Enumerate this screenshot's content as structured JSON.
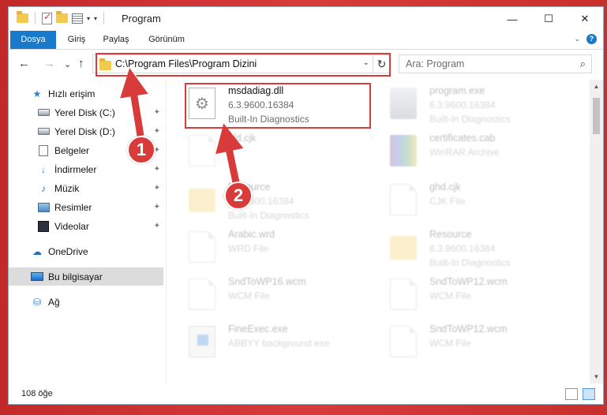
{
  "window": {
    "title": "Program",
    "controls": {
      "minimize": "—",
      "maximize": "☐",
      "close": "✕"
    }
  },
  "ribbon": {
    "tabs": [
      "Dosya",
      "Giriş",
      "Paylaş",
      "Görünüm"
    ]
  },
  "navbar": {
    "back": "←",
    "forward": "→",
    "recent": "⌄",
    "up": "↑",
    "address": "C:\\Program Files\\Program Dizini",
    "refresh": "↻",
    "search_placeholder": "Ara: Program"
  },
  "sidebar": {
    "items": [
      {
        "label": "Hızlı erişim",
        "icon": "star-icon"
      },
      {
        "label": "Yerel Disk (C:)",
        "icon": "drive-icon",
        "pinned": true
      },
      {
        "label": "Yerel Disk (D:)",
        "icon": "drive-icon",
        "pinned": true
      },
      {
        "label": "Belgeler",
        "icon": "documents-icon",
        "pinned": true
      },
      {
        "label": "İndirmeler",
        "icon": "download-icon",
        "pinned": true
      },
      {
        "label": "Müzik",
        "icon": "music-icon",
        "pinned": true
      },
      {
        "label": "Resimler",
        "icon": "pictures-icon",
        "pinned": true
      },
      {
        "label": "Videolar",
        "icon": "videos-icon",
        "pinned": true
      },
      {
        "label": "OneDrive",
        "icon": "cloud-icon"
      },
      {
        "label": "Bu bilgisayar",
        "icon": "computer-icon",
        "selected": true
      },
      {
        "label": "Ağ",
        "icon": "network-icon"
      }
    ],
    "pin_glyph": "📌"
  },
  "files": [
    {
      "name": "msdadiag.dll",
      "line2": "6.3.9600.16384",
      "line3": "Built-In Diagnostics",
      "icon": "dll-gear-icon",
      "highlighted": true
    },
    {
      "name": "program.exe",
      "line2": "6.3.9600.16384",
      "line3": "Built-In Diagnostics",
      "icon": "app-icon"
    },
    {
      "name": "bld.cjk",
      "line2": "",
      "line3": "",
      "icon": "file-icon"
    },
    {
      "name": "certificates.cab",
      "line2": "WinRAR Archive",
      "line3": "",
      "icon": "rar-icon"
    },
    {
      "name": "Resource",
      "line2": "6.3.9600.16384",
      "line3": "Built-In Diagnostics",
      "icon": "folder-icon"
    },
    {
      "name": "ghd.cjk",
      "line2": "CJK File",
      "line3": "",
      "icon": "file-icon"
    },
    {
      "name": "Arabic.wrd",
      "line2": "WRD File",
      "line3": "",
      "icon": "file-icon"
    },
    {
      "name": "Resource",
      "line2": "6.3.9600.16384",
      "line3": "Built-In Diagnostics",
      "icon": "folder-icon"
    },
    {
      "name": "SndToWP16.wcm",
      "line2": "WCM File",
      "line3": "",
      "icon": "file-icon"
    },
    {
      "name": "SndToWP12.wcm",
      "line2": "WCM File",
      "line3": "",
      "icon": "file-icon"
    },
    {
      "name": "FineExec.exe",
      "line2": "ABBYY background exe",
      "line3": "",
      "icon": "exe-icon"
    },
    {
      "name": "SndToWP12.wcm",
      "line2": "WCM File",
      "line3": "",
      "icon": "file-icon"
    }
  ],
  "status": {
    "item_count": "108 öğe"
  },
  "callouts": [
    "1",
    "2"
  ],
  "colors": {
    "highlight": "#d93b3b",
    "ribbon_file_tab": "#1979ca",
    "selected_nav": "#dcdcdc"
  }
}
